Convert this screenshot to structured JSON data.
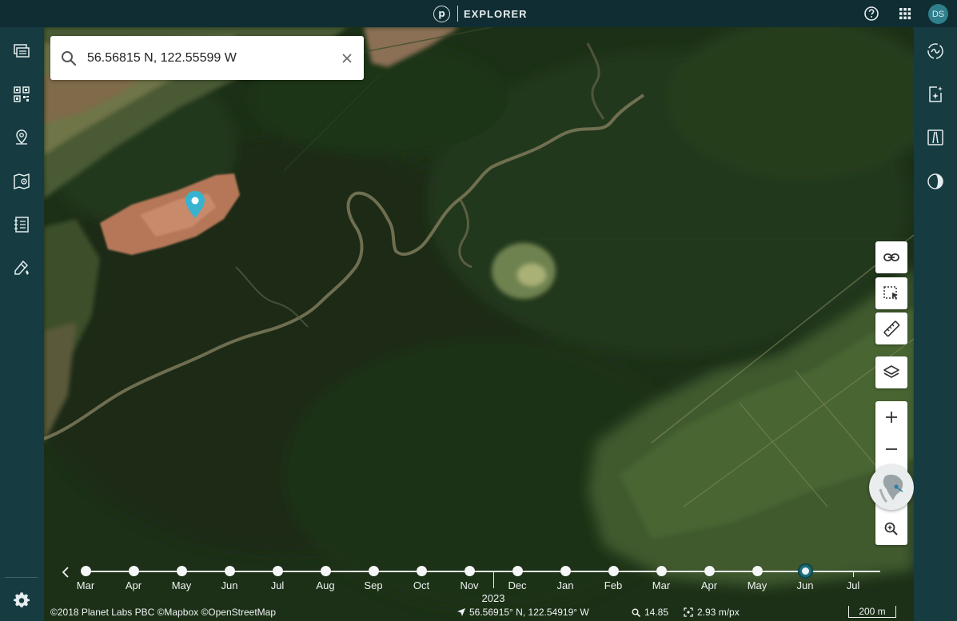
{
  "app": {
    "title": "EXPLORER",
    "logo_letter": "p"
  },
  "user": {
    "initials": "DS"
  },
  "icons": {
    "top": [
      "help-icon",
      "apps-grid-icon"
    ],
    "left_sidebar": [
      "mosaics-icon",
      "qr-grid-icon",
      "location-pin-icon",
      "map-location-icon",
      "notebook-icon",
      "draw-tool-icon",
      "settings-icon"
    ],
    "right_sidebar": [
      "analysis-icon",
      "ai-sparkle-icon",
      "road-icon",
      "contrast-icon"
    ],
    "map_controls": [
      "link-icon",
      "select-area-icon",
      "ruler-icon",
      "layers-icon",
      "plus-icon",
      "minus-icon",
      "globe-icon",
      "zoom-search-icon"
    ]
  },
  "search": {
    "value": "56.56815 N, 122.55599 W",
    "placeholder": ""
  },
  "timeline": {
    "months": [
      "Mar",
      "Apr",
      "May",
      "Jun",
      "Jul",
      "Aug",
      "Sep",
      "Oct",
      "Nov",
      "Dec",
      "Jan",
      "Feb",
      "Mar",
      "Apr",
      "May",
      "Jun",
      "Jul"
    ],
    "year_label": "2023",
    "selected_month": "Jun"
  },
  "footer": {
    "attribution": "©2018 Planet Labs PBC ©Mapbox ©OpenStreetMap",
    "cursor_coordinates": "56.56915° N, 122.54919° W",
    "zoom": "14.85",
    "resolution": "2.93 m/px",
    "scale": "200 m"
  },
  "colors": {
    "header": "#0f2d32",
    "sidebar": "#163b40",
    "accent": "#2fa8c4",
    "pin": "#37b3d0"
  }
}
